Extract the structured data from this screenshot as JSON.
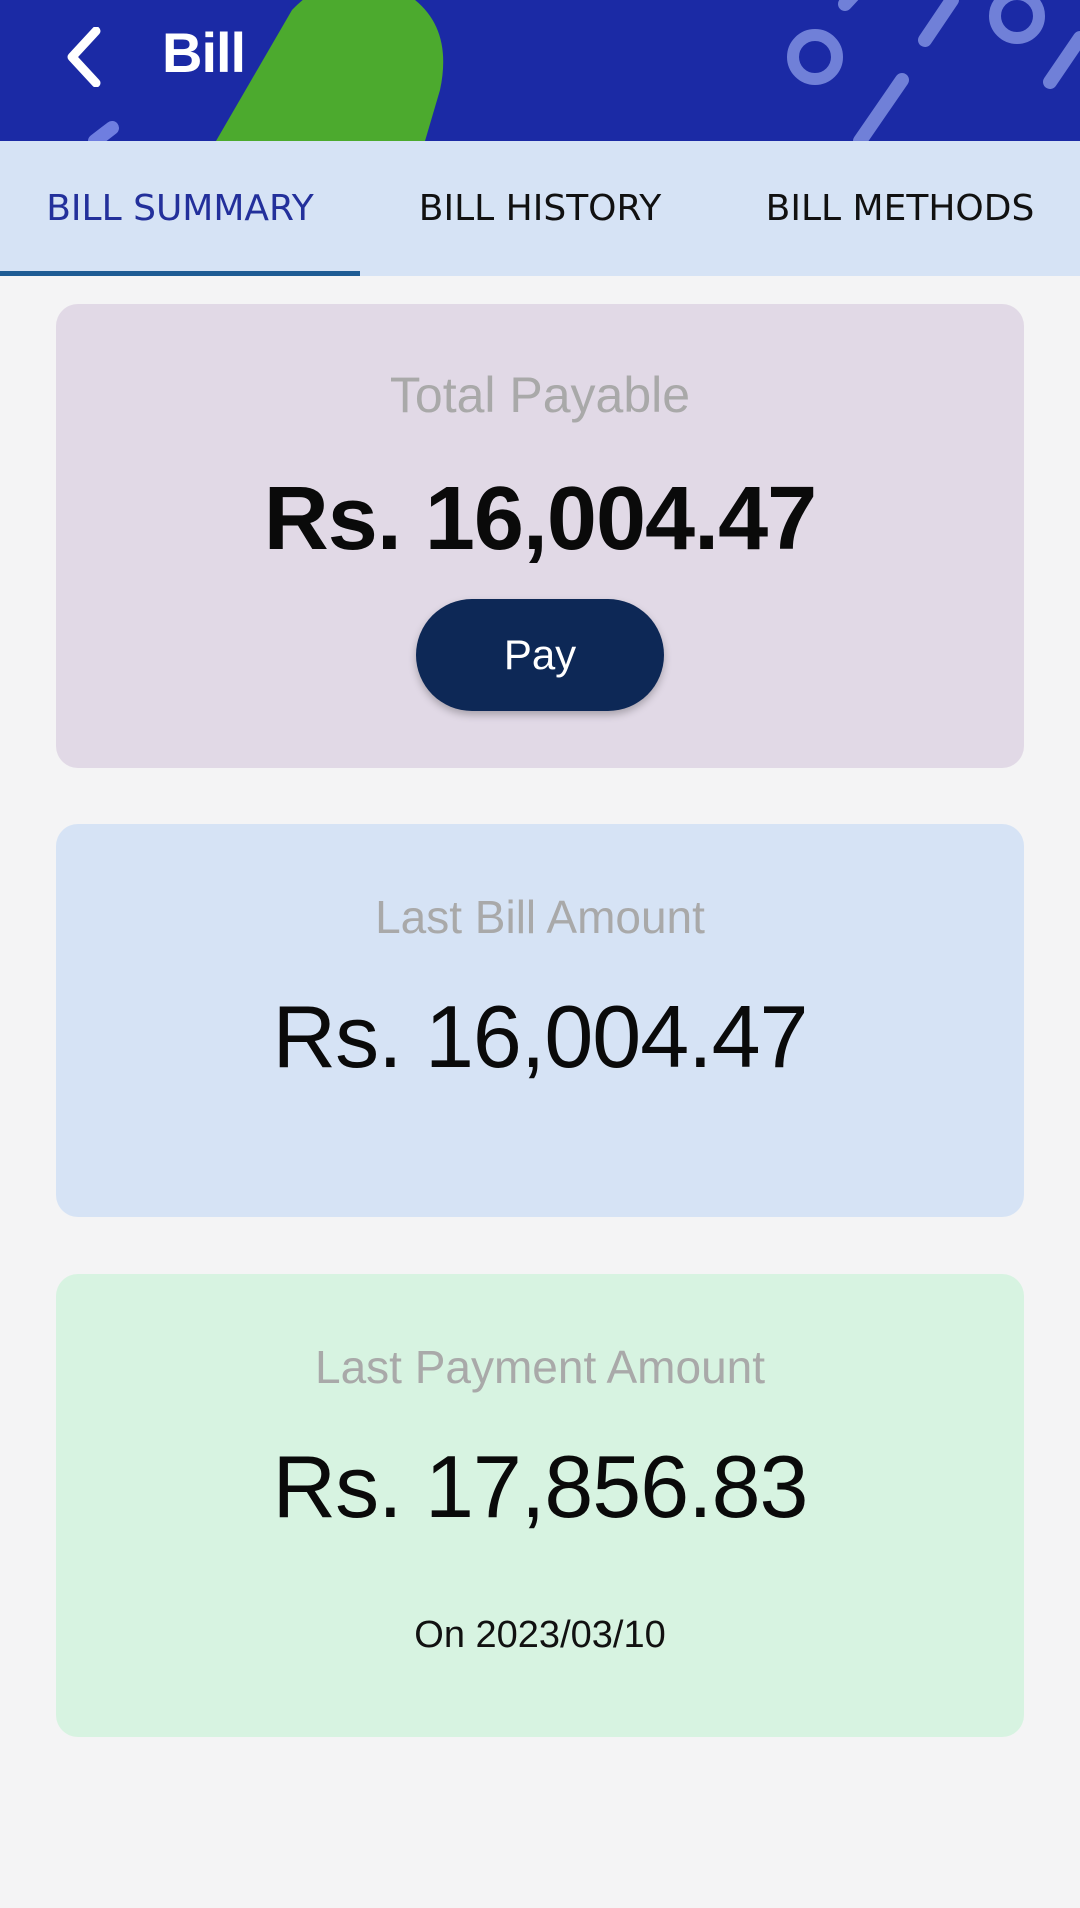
{
  "header": {
    "title": "Bill",
    "background_color": "#1b2aa5",
    "back_icon": "chevron-left-icon"
  },
  "tabs": [
    {
      "label": "BILL SUMMARY",
      "selected": true
    },
    {
      "label": "BILL HISTORY",
      "selected": false
    },
    {
      "label": "BILL METHODS",
      "selected": false
    }
  ],
  "summary": {
    "total_payable": {
      "label": "Total Payable",
      "amount": "Rs. 16,004.47",
      "pay_button_label": "Pay",
      "background_color": "#e1d9e6"
    },
    "last_bill": {
      "label": "Last Bill Amount",
      "amount": "Rs. 16,004.47",
      "background_color": "#d6e3f5"
    },
    "last_payment": {
      "label": "Last Payment Amount",
      "amount": "Rs. 17,856.83",
      "date": "On 2023/03/10",
      "background_color": "#d7f3e1"
    }
  },
  "colors": {
    "accent": "#23309b",
    "tab_indicator": "#1e5c94",
    "pay_button": "#0d2856",
    "decor_green": "#4caa2e"
  }
}
